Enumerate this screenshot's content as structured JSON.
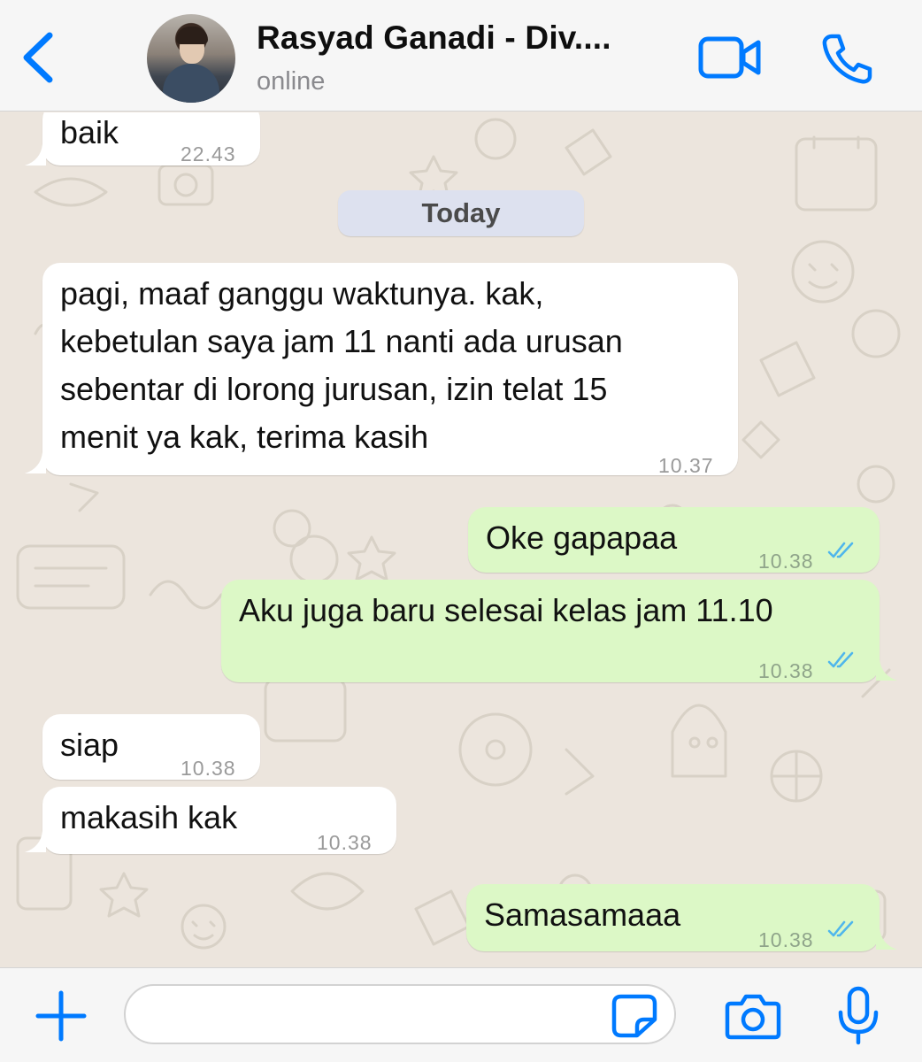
{
  "header": {
    "contact_name": "Rasyad Ganadi - Div....",
    "status": "online"
  },
  "date_separator": "Today",
  "messages": [
    {
      "direction": "incoming",
      "text": "baik",
      "time": "22.43"
    },
    {
      "direction": "incoming",
      "text": "pagi, maaf ganggu waktunya. kak,\nkebetulan saya jam 11 nanti ada urusan\nsebentar di lorong jurusan, izin telat 15\nmenit ya kak, terima kasih",
      "time": "10.37"
    },
    {
      "direction": "outgoing",
      "text": "Oke gapapaa",
      "time": "10.38",
      "status": "read"
    },
    {
      "direction": "outgoing",
      "text": "Aku juga baru selesai kelas jam 11.10",
      "time": "10.38",
      "status": "read"
    },
    {
      "direction": "incoming",
      "text": "siap",
      "time": "10.38"
    },
    {
      "direction": "incoming",
      "text": "makasih kak",
      "time": "10.38"
    },
    {
      "direction": "outgoing",
      "text": "Samasamaaa",
      "time": "10.38",
      "status": "read"
    }
  ],
  "input": {
    "value": "",
    "placeholder": ""
  },
  "icons": {
    "back": "chevron-left-icon",
    "video": "video-camera-icon",
    "call": "phone-icon",
    "attach": "plus-icon",
    "sticker": "sticker-icon",
    "camera": "camera-icon",
    "mic": "microphone-icon"
  },
  "colors": {
    "accent": "#007aff",
    "outgoing_bubble": "#dcf8c6",
    "incoming_bubble": "#ffffff",
    "chat_background": "#ece5dd",
    "read_ticks": "#4fb6ec",
    "date_pill": "#dde1ef"
  }
}
